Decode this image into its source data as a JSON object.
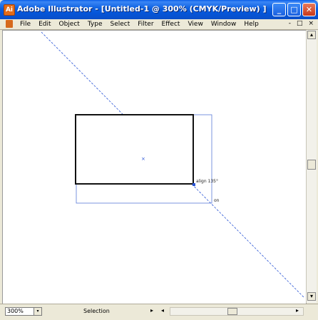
{
  "window": {
    "title": "Adobe Illustrator - [Untitled-1 @ 300% (CMYK/Preview) ]",
    "controls": {
      "minimize": "_",
      "maximize": "□",
      "close": "✕"
    }
  },
  "menubar": {
    "items": [
      "File",
      "Edit",
      "Object",
      "Type",
      "Select",
      "Filter",
      "Effect",
      "View",
      "Window",
      "Help"
    ],
    "doc_controls": [
      "-",
      "□",
      "×"
    ]
  },
  "canvas": {
    "smart_guides": {
      "align_label": "align 135°",
      "on_label": "on"
    },
    "center_mark": "×"
  },
  "status": {
    "zoom": "300%",
    "tool": "Selection",
    "tool_arrow": "▸",
    "left_arrow": "◂",
    "right_arrow": "▸"
  },
  "scrollbar": {
    "up": "▴",
    "down": "▾"
  },
  "colors": {
    "title_blue": "#0a5ee8",
    "guide_blue": "#2a55d6",
    "chrome": "#ece9d8"
  }
}
